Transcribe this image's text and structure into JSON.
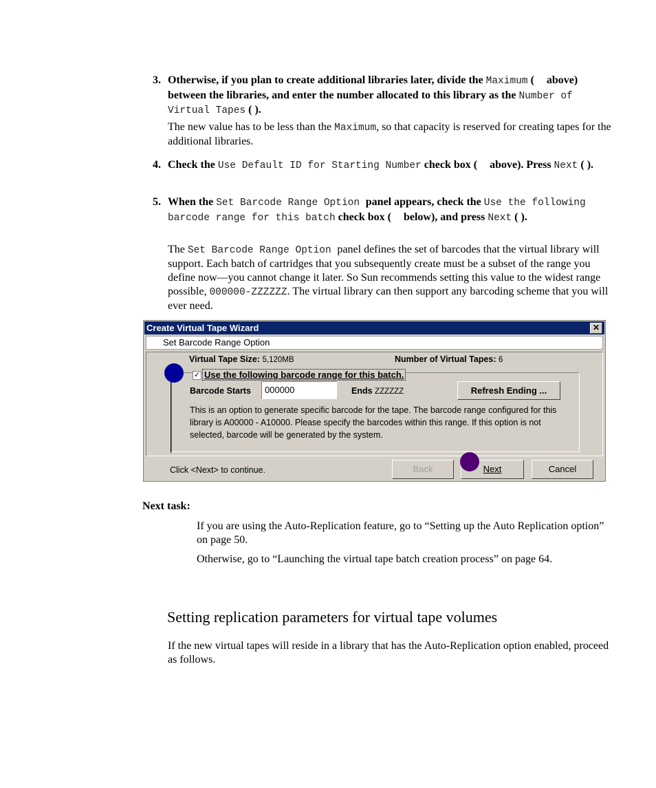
{
  "steps": [
    {
      "number": "3.",
      "segments": [
        {
          "t": "b",
          "v": "Otherwise, if you plan to create additional libraries later, divide the "
        },
        {
          "t": "m",
          "v": "Maximum"
        },
        {
          "t": "b",
          "v": " ( "
        },
        {
          "t": "gap"
        },
        {
          "t": "b",
          "v": " above) between the libraries, and enter the number allocated to this library as the "
        },
        {
          "t": "m",
          "v": "Number of Virtual Tapes"
        },
        {
          "t": "b",
          "v": " ( )."
        }
      ],
      "note": [
        {
          "t": "n",
          "v": "The new value has to be less than the "
        },
        {
          "t": "m",
          "v": "Maximum"
        },
        {
          "t": "n",
          "v": ", so that capacity is reserved for creating tapes for the additional libraries."
        }
      ]
    },
    {
      "number": "4.",
      "segments": [
        {
          "t": "b",
          "v": "Check the "
        },
        {
          "t": "m",
          "v": "Use Default ID for Starting Number"
        },
        {
          "t": "b",
          "v": " check box ( "
        },
        {
          "t": "gap"
        },
        {
          "t": "b",
          "v": " above). Press "
        },
        {
          "t": "m",
          "v": "Next"
        },
        {
          "t": "b",
          "v": " ( )."
        }
      ]
    },
    {
      "number": "5.",
      "segments": [
        {
          "t": "b",
          "v": "When the "
        },
        {
          "t": "m",
          "v": "Set Barcode Range Option "
        },
        {
          "t": "b",
          "v": " panel appears, check the "
        },
        {
          "t": "m",
          "v": "Use the following barcode range for this batch"
        },
        {
          "t": "b",
          "v": " check box ( "
        },
        {
          "t": "gap"
        },
        {
          "t": "b",
          "v": " below), and press "
        },
        {
          "t": "m",
          "v": "Next"
        },
        {
          "t": "b",
          "v": " ( )."
        }
      ],
      "note": [
        {
          "t": "n",
          "v": "The "
        },
        {
          "t": "m",
          "v": "Set Barcode Range Option "
        },
        {
          "t": "n",
          "v": " panel defines the set of barcodes that the virtual library will support. Each batch of cartridges that you subsequently create must be a subset of the range you define now—you cannot change it later. So Sun recommends setting this value to the widest range possible, "
        },
        {
          "t": "m",
          "v": "000000-ZZZZZZ"
        },
        {
          "t": "n",
          "v": ". The virtual library can then support any barcoding scheme that you will ever need."
        }
      ]
    }
  ],
  "dialog": {
    "title": "Create Virtual Tape Wizard",
    "close_icon": "close-icon",
    "header": "Set Barcode Range Option",
    "tape_size_label": "Virtual Tape Size:",
    "tape_size_value": "5,120MB",
    "num_tapes_label": "Number of Virtual Tapes:",
    "num_tapes_value": "6",
    "checkbox_checked": true,
    "checkbox_label": "Use the following barcode range for this batch.",
    "barcode_starts_label": "Barcode Starts",
    "barcode_starts_value": "000000",
    "ends_label": "Ends",
    "ends_value": "ZZZZZZ",
    "refresh_button": "Refresh Ending ...",
    "help_text": "This is an option to generate specific barcode for the tape. The barcode range configured for this library is A00000 - A10000. Please specify the barcodes within this range. If this option is not selected, barcode will be generated by the system.",
    "status_text": "Click <Next> to continue.",
    "back_button": "Back",
    "next_button": "Next",
    "cancel_button": "Cancel",
    "marker_colors": {
      "checkbox_marker": "#00009a",
      "next_marker": "#500070"
    }
  },
  "next_task": {
    "heading": "Next task:",
    "items": [
      "If you are using the Auto-Replication feature, go to “Setting up the Auto Replication option” on page 50.",
      "Otherwise, go to “Launching the virtual tape batch creation process” on page 64."
    ]
  },
  "section": {
    "title": "Setting replication parameters for virtual tape volumes",
    "intro": "If the new virtual tapes will reside in a library that has the Auto-Replication option enabled, proceed as follows."
  }
}
